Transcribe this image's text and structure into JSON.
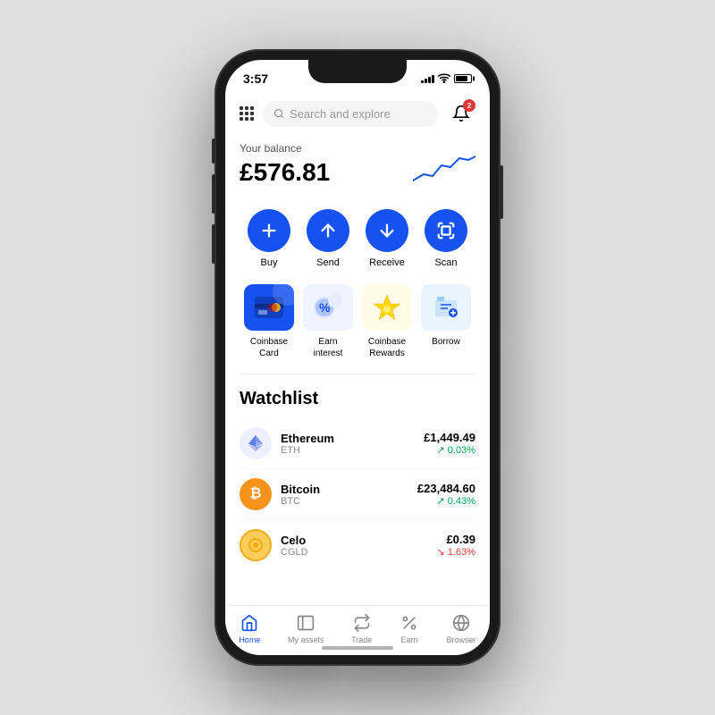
{
  "status": {
    "time": "3:57",
    "notif_badge": "2"
  },
  "header": {
    "search_placeholder": "Search and explore"
  },
  "balance": {
    "label": "Your balance",
    "amount": "£576.81"
  },
  "quick_actions": [
    {
      "id": "buy",
      "label": "Buy",
      "icon": "plus"
    },
    {
      "id": "send",
      "label": "Send",
      "icon": "arrow-up"
    },
    {
      "id": "receive",
      "label": "Receive",
      "icon": "arrow-down"
    },
    {
      "id": "scan",
      "label": "Scan",
      "icon": "scan"
    }
  ],
  "features": [
    {
      "id": "coinbase-card",
      "label": "Coinbase\nCard"
    },
    {
      "id": "earn-interest",
      "label": "Earn\ninterest"
    },
    {
      "id": "coinbase-rewards",
      "label": "Coinbase\nRewards"
    },
    {
      "id": "borrow",
      "label": "Borrow"
    }
  ],
  "watchlist": {
    "title": "Watchlist",
    "items": [
      {
        "name": "Ethereum",
        "symbol": "ETH",
        "price": "£1,449.49",
        "change": "↗ 0.03%",
        "positive": true,
        "color": "#627eea"
      },
      {
        "name": "Bitcoin",
        "symbol": "BTC",
        "price": "£23,484.60",
        "change": "↗ 0.43%",
        "positive": true,
        "color": "#f7931a"
      },
      {
        "name": "Celo",
        "symbol": "CGLD",
        "price": "£0.39",
        "change": "↘ 1.63%",
        "positive": false,
        "color": "#fbcc5c"
      }
    ]
  },
  "bottom_nav": [
    {
      "id": "home",
      "label": "Home",
      "active": true
    },
    {
      "id": "my-assets",
      "label": "My assets",
      "active": false
    },
    {
      "id": "trade",
      "label": "Trade",
      "active": false
    },
    {
      "id": "earn",
      "label": "Earn",
      "active": false
    },
    {
      "id": "browser",
      "label": "Browser",
      "active": false
    }
  ]
}
